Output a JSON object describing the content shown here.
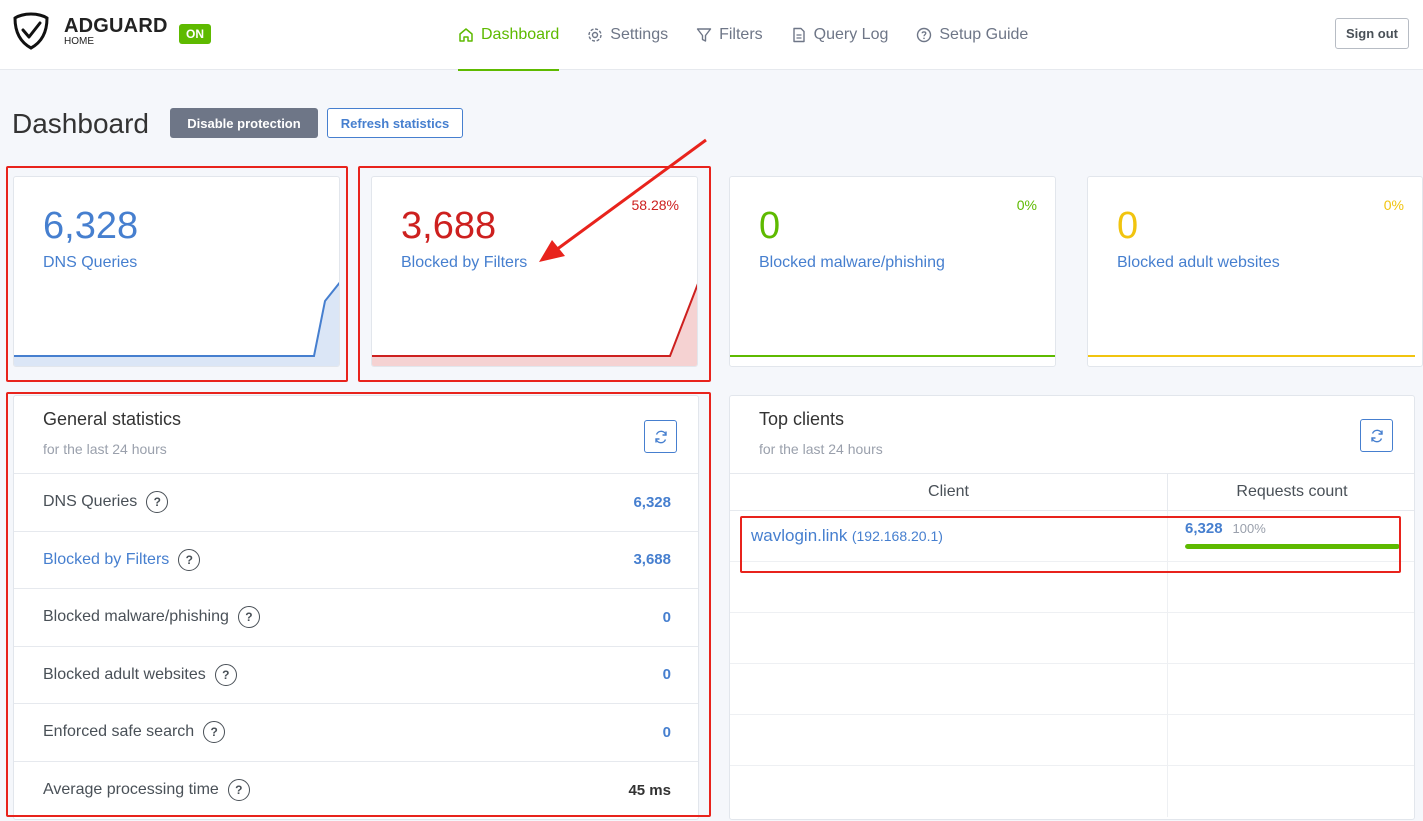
{
  "header": {
    "brand_name": "ADGUARD",
    "brand_sub": "HOME",
    "status_badge": "ON",
    "nav": [
      {
        "label": "Dashboard",
        "icon": "home-icon",
        "active": true
      },
      {
        "label": "Settings",
        "icon": "gear-icon",
        "active": false
      },
      {
        "label": "Filters",
        "icon": "filter-icon",
        "active": false
      },
      {
        "label": "Query Log",
        "icon": "document-icon",
        "active": false
      },
      {
        "label": "Setup Guide",
        "icon": "help-circle-icon",
        "active": false
      }
    ],
    "sign_out": "Sign out"
  },
  "page": {
    "title": "Dashboard",
    "disable_protection": "Disable protection",
    "refresh_statistics": "Refresh statistics"
  },
  "stats": [
    {
      "value": "6,328",
      "label": "DNS Queries",
      "percent": "",
      "color": "#467fcf"
    },
    {
      "value": "3,688",
      "label": "Blocked by Filters",
      "percent": "58.28%",
      "color": "#cd201f"
    },
    {
      "value": "0",
      "label": "Blocked malware/phishing",
      "percent": "0%",
      "color": "#5eba00"
    },
    {
      "value": "0",
      "label": "Blocked adult websites",
      "percent": "0%",
      "color": "#f1c40f"
    }
  ],
  "general": {
    "title": "General statistics",
    "subtitle": "for the last 24 hours",
    "rows": [
      {
        "label": "DNS Queries",
        "value": "6,328"
      },
      {
        "label": "Blocked by Filters",
        "value": "3,688"
      },
      {
        "label": "Blocked malware/phishing",
        "value": "0"
      },
      {
        "label": "Blocked adult websites",
        "value": "0"
      },
      {
        "label": "Enforced safe search",
        "value": "0"
      },
      {
        "label": "Average processing time",
        "value": "45 ms"
      }
    ]
  },
  "clients": {
    "title": "Top clients",
    "subtitle": "for the last 24 hours",
    "col_client": "Client",
    "col_requests": "Requests count",
    "rows": [
      {
        "name": "wavlogin.link",
        "ip": "(192.168.20.1)",
        "count": "6,328",
        "percent": "100%",
        "fill": 1.0
      }
    ]
  },
  "help_glyph": "?"
}
